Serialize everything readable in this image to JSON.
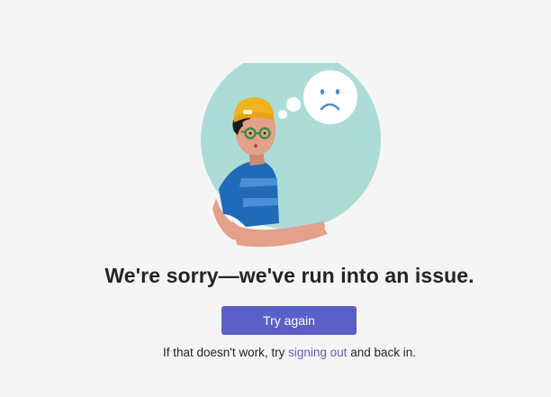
{
  "error": {
    "title": "We're sorry—we've run into an issue.",
    "retry_label": "Try again",
    "hint_prefix": "If that doesn't work, try ",
    "hint_link": "signing out",
    "hint_suffix": " and back in."
  },
  "illustration": {
    "name": "sad-person-illustration",
    "colors": {
      "circle": "#acdcd6",
      "bubble": "#ffffff",
      "face": "#4a90c8",
      "skin": "#e3a08a",
      "hat": "#f0b21e",
      "shirt": "#1f6bb8",
      "stripes": "#4d8ed4",
      "glasses": "#2e8b3a",
      "hair": "#1a1a1a"
    }
  },
  "colors": {
    "accent": "#5b5fc7",
    "text": "#252423",
    "background": "#f5f5f5"
  }
}
